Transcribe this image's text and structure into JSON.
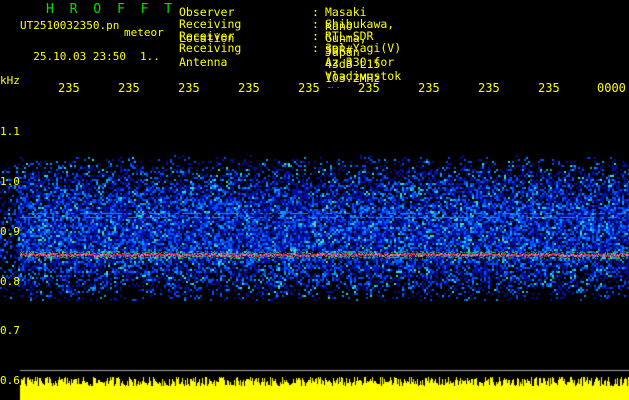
{
  "header": {
    "app": "H R O F F T",
    "filename": "UT2510032350.pn",
    "meteor_label": "meteor",
    "datetime": "25.10.03 23:50",
    "counter": "1..",
    "info": [
      {
        "key": "Observer",
        "value": "Masaki Kano"
      },
      {
        "key": "Receiving Location",
        "value": "Shibukawa, Gunma, Japan"
      },
      {
        "key": "Receiver",
        "value": "RTL-SDR SDR# 43dB L15 103.2MHz CW"
      },
      {
        "key": "Receiving Antenna",
        "value": "3el Yagi(V) Az 330 for Vladivostok"
      }
    ]
  },
  "axes": {
    "y_unit": "kHz",
    "y_ticks": [
      "1.1",
      "1.0",
      "0.9",
      "0.8",
      "0.7",
      "0.6"
    ],
    "x_ticks": [
      "235",
      "235",
      "235",
      "235",
      "235",
      "235",
      "235",
      "235",
      "235",
      "0000"
    ]
  },
  "colors": {
    "text": "#ffff00",
    "title": "#00e000",
    "band": "#0030c0",
    "carrier": "#ff3040",
    "bars": "#ffff00",
    "gridline": "#a0a0a0"
  }
}
